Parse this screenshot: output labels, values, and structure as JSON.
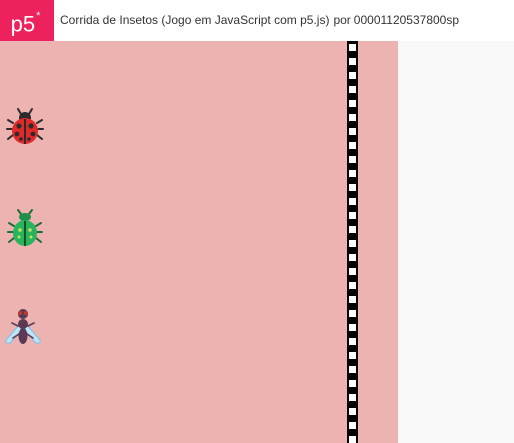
{
  "header": {
    "logo": "p5",
    "logo_mark": "*",
    "sketch_title": "Corrida de Insetos (Jogo em JavaScript com p5.js)",
    "by_label": "por",
    "author": "00001120537800sp"
  },
  "game": {
    "background_color": "#ecb3b0",
    "racers": [
      {
        "icon": "ladybug-icon"
      },
      {
        "icon": "beetle-icon"
      },
      {
        "icon": "fly-icon"
      }
    ],
    "finish_line": "checkered-black-white"
  }
}
